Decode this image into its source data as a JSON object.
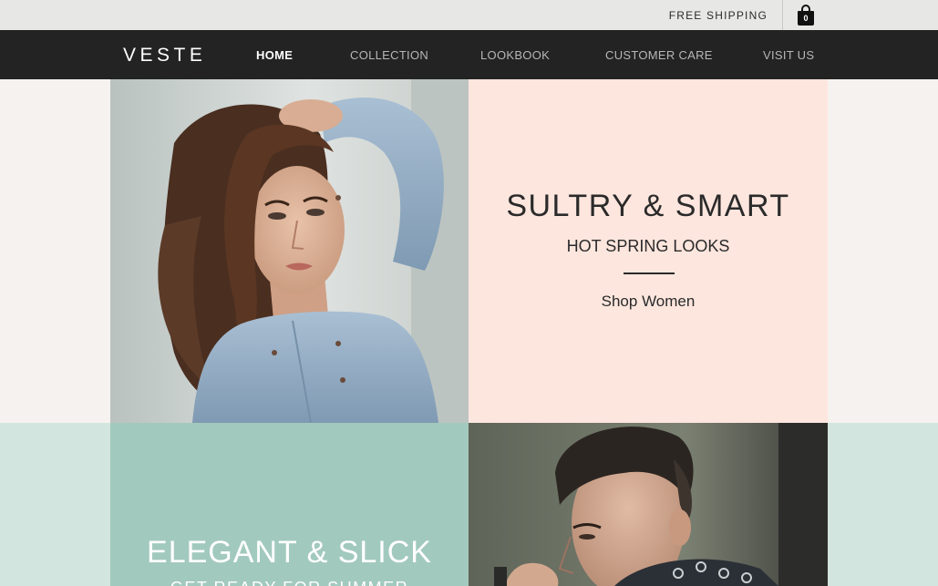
{
  "utility_bar": {
    "shipping_label": "FREE SHIPPING",
    "cart_count": "0",
    "cart_icon": "shopping-bag-icon"
  },
  "nav": {
    "logo": "VESTE",
    "items": [
      {
        "label": "HOME",
        "active": true
      },
      {
        "label": "COLLECTION",
        "active": false
      },
      {
        "label": "LOOKBOOK",
        "active": false
      },
      {
        "label": "CUSTOMER CARE",
        "active": false
      },
      {
        "label": "VISIT US",
        "active": false
      }
    ]
  },
  "promos": [
    {
      "title": "SULTRY & SMART",
      "subtitle": "HOT SPRING LOOKS",
      "link": "Shop Women"
    },
    {
      "title": "ELEGANT & SLICK",
      "subtitle": "GET READY FOR SUMMER"
    }
  ],
  "colors": {
    "nav_bg": "#232323",
    "utility_bg": "#e7e7e6",
    "pink_tile": "#fde6de",
    "mint_tile": "#a2c9bd",
    "mint_band": "#d3e5df",
    "page_bg": "#f6f2f0"
  }
}
